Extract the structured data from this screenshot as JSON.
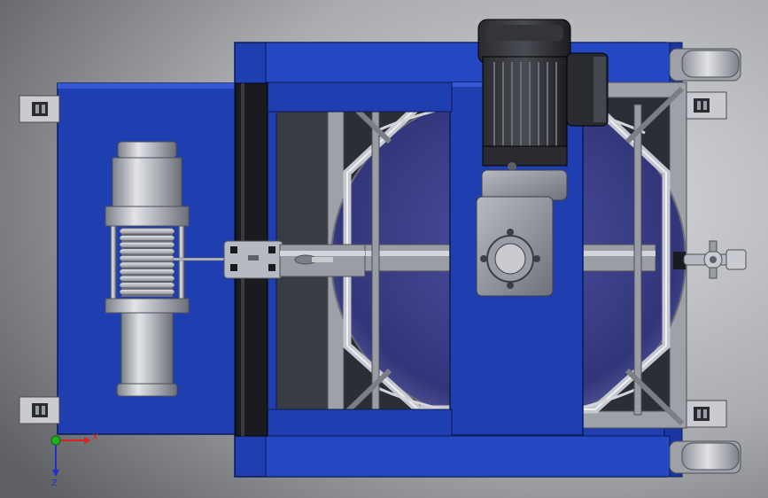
{
  "axis_triad": {
    "x_label": "X",
    "y_label": "Y",
    "z_label": "Z"
  },
  "colors": {
    "background_light": "#b9bbbe",
    "background_dark": "#6e7074",
    "frame_blue": "#1f3fb0",
    "frame_blue_light": "#3657d6",
    "frame_blue_dark": "#13287a",
    "steel": "#a9acb3",
    "steel_light": "#d3d5da",
    "steel_dark": "#5d6068",
    "motor_black": "#1d1e22",
    "vessel_purple": "#3c3f86",
    "axis_red": "#e02020",
    "axis_green": "#20b020",
    "axis_blue": "#2030d0"
  }
}
